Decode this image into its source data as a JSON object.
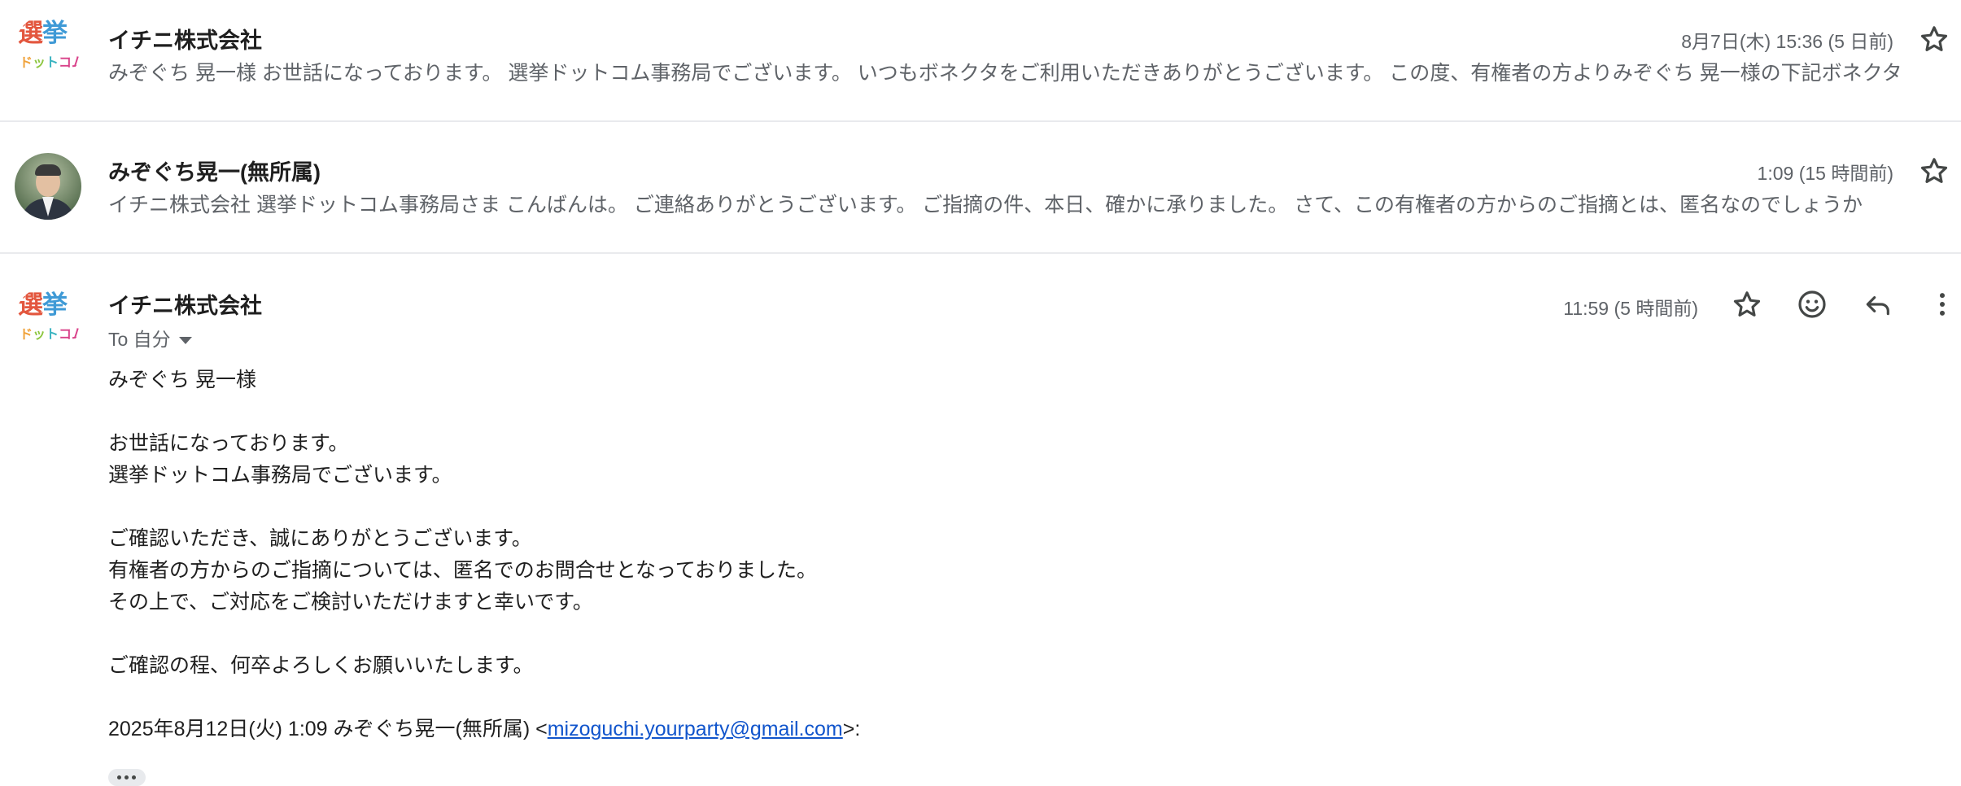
{
  "thread": [
    {
      "sender": "イチニ株式会社",
      "date": "8月7日(木) 15:36 (5 日前)",
      "snippet": "みぞぐち 晃一様 お世話になっております。 選挙ドットコム事務局でございます。 いつもボネクタをご利用いただきありがとうございます。 この度、有権者の方よりみぞぐち 晃一様の下記ボネクタ",
      "avatar": {
        "logo_top": [
          "選",
          "挙"
        ],
        "logo_bottom": [
          "ド",
          "ッ",
          "ト",
          "コム"
        ]
      }
    },
    {
      "sender": "みぞぐち晃一(無所属)",
      "date": "1:09 (15 時間前)",
      "snippet": "イチニ株式会社 選挙ドットコム事務局さま こんばんは。 ご連絡ありがとうございます。 ご指摘の件、本日、確かに承りました。 さて、この有権者の方からのご指摘とは、匿名なのでしょうか"
    }
  ],
  "open_message": {
    "sender": "イチニ株式会社",
    "date": "11:59 (5 時間前)",
    "to": "To 自分",
    "avatar": {
      "logo_top": [
        "選",
        "挙"
      ],
      "logo_bottom": [
        "ド",
        "ッ",
        "ト",
        "コム"
      ]
    },
    "body": {
      "greeting": "みぞぐち 晃一様",
      "line1": "お世話になっております。",
      "line2": "選挙ドットコム事務局でございます。",
      "line3": "ご確認いただき、誠にありがとうございます。",
      "line4": "有権者の方からのご指摘については、匿名でのお問合せとなっておりました。",
      "line5": "その上で、ご対応をご検討いただけますと幸いです。",
      "line6": "ご確認の程、何卒よろしくお願いいたします。",
      "quote_prefix": "2025年8月12日(火) 1:09 みぞぐち晃一(無所属) <",
      "quote_email": "mizoguchi.yourparty@gmail.com",
      "quote_suffix": ">:"
    }
  },
  "icons": [
    "star-icon",
    "emoji-icon",
    "reply-icon",
    "more-vert-icon",
    "chevron-down-icon",
    "more-horiz-icon"
  ],
  "colors": {
    "link": "#1155cc",
    "muted": "#5f6368",
    "text": "#1f1f1f",
    "divider": "#e9eaed"
  }
}
